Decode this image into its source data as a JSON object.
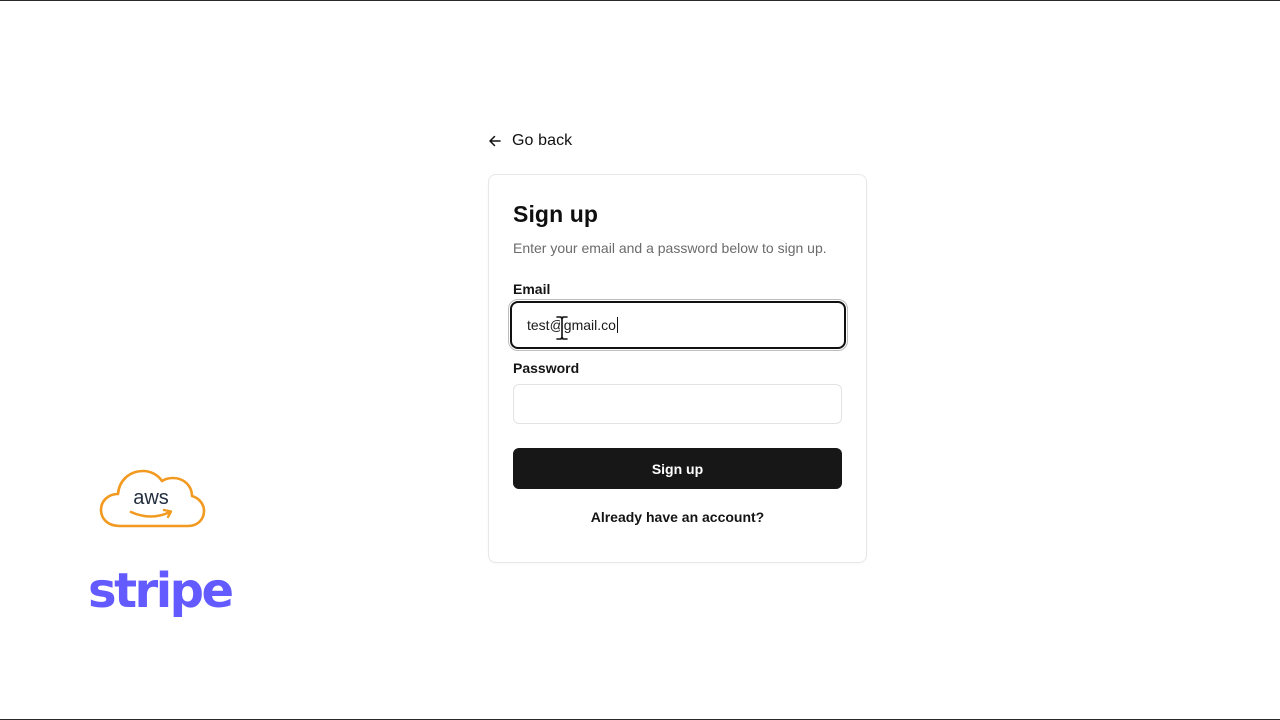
{
  "navigation": {
    "back_label": "Go back",
    "back_icon": "arrow-left-icon"
  },
  "card": {
    "title": "Sign up",
    "subtitle": "Enter your email and a password below to sign up.",
    "email": {
      "label": "Email",
      "value": "test@gmail.co",
      "focused": true
    },
    "password": {
      "label": "Password",
      "value": ""
    },
    "submit_label": "Sign up",
    "signin_link": "Already have an account?"
  },
  "logos": {
    "aws": "aws",
    "stripe": "stripe"
  },
  "colors": {
    "aws_orange": "#f29a1f",
    "stripe_purple": "#635bff",
    "button_dark": "#171717"
  }
}
